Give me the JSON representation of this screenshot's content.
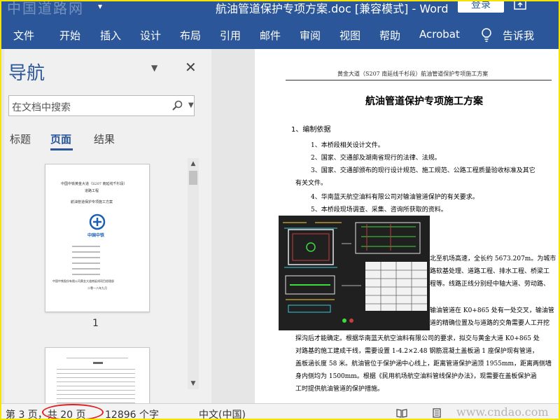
{
  "titlebar": {
    "watermark": "中国道路网",
    "document_title": "航油管道保护专项方案.doc [兼容模式] - Word",
    "login_label": "登录"
  },
  "ribbon": {
    "tabs": [
      "文件",
      "开始",
      "插入",
      "设计",
      "布局",
      "引用",
      "邮件",
      "审阅",
      "视图",
      "帮助",
      "Acrobat"
    ],
    "tell_me": "告诉我"
  },
  "nav": {
    "title": "导航",
    "search_placeholder": "在文档中搜索",
    "tabs": [
      "标题",
      "页面",
      "结果"
    ],
    "active_tab": "页面",
    "thumb1": {
      "line1": "中国中铁黄金大道（S207 南延线千杉段）",
      "line2": "道路工程",
      "line3": "航油管道保护专项施工方案",
      "logo_text": "中国中铁",
      "footer1": "中国中铁股份有限公司黄金大道南延线项目经理部",
      "footer2": "二零一八年九月"
    },
    "page1_number": "1"
  },
  "document": {
    "running_header": "黄金大道（S207 南延线千杉段）航油管道保护专项施工方案",
    "heading": "航油管道保护专项施工方案",
    "section1": "1、编制依据",
    "items": [
      "1、本桥段相关设计文件。",
      "2、国家、交通部及湖南省现行的法律、法规。",
      "3、国家、交通部颁布的现行设计规范、施工规范、公路工程质量验收标准及其它",
      "有关文件。",
      "4、华南蓝天航空油料有限公司对输油管道保护的有关要求。",
      "5、本桥段现场调查、采集、咨询所获取的资料。"
    ],
    "right_fragments": [
      "北至机场高速，全长约 5673.207m。为城市",
      "路软基处理、道路工程、排水工程、桥梁工",
      "程等。线路正线分别经中轴大道、劳动路、",
      "输油管道在 K0+865 处有一处交叉，输油管",
      "道的精确位置及与道路的交角需要人工开挖"
    ],
    "lower_lines": [
      "探沟后才能确定。根据华南蓝天航空油料有限公司的要求，拟交与黄金大道 K0+865 处",
      "对路基的施工建成干线，需要设置 1-4.2×2.48 钢筋混凝土盖板涵 1 座保护现有管道，",
      "盖板涵长度 58 米。航油管位于保护涵中心线上，距离管道保护涵顶 1955mm，距离两侧墙",
      "身内侧均为 1500mm。根据《民用机场航空油料管线保护办法》，现需要在盖板保护涵",
      "工时提供航油管道的保护措施。"
    ]
  },
  "status": {
    "page": "第 3 页，共 20 页",
    "words": "12896 个字",
    "language": "中文(中国)",
    "watermark": "www.cndao.com"
  },
  "colors": {
    "ribbon_blue": "#2b579a",
    "frame_yellow": "#f5e400",
    "annotation_red": "#e02020"
  }
}
